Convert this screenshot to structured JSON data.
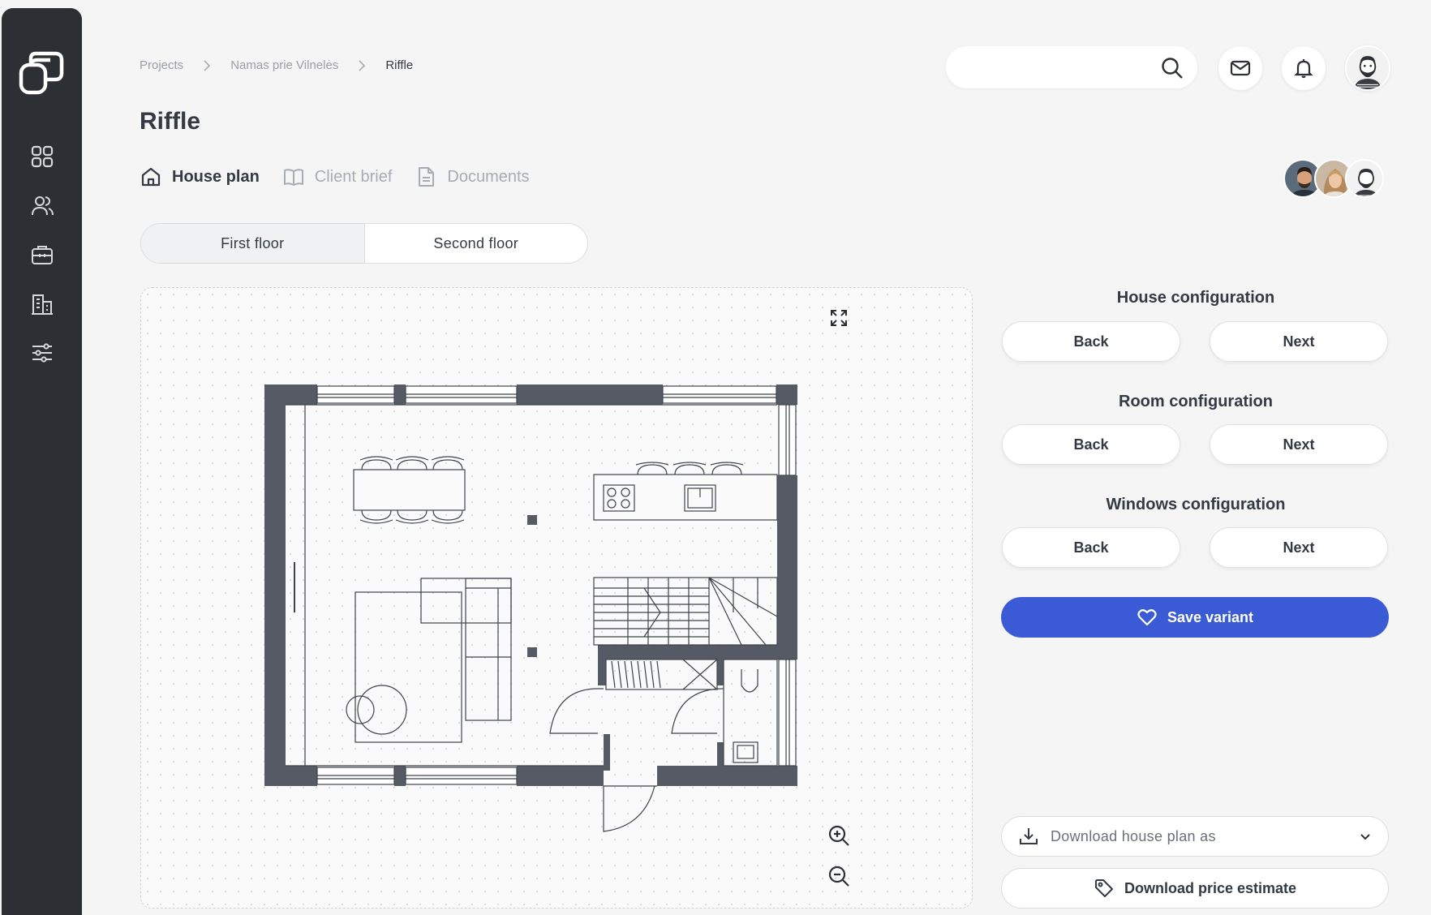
{
  "breadcrumb": {
    "items": [
      "Projects",
      "Namas prie Vilnelės",
      "Riffle"
    ]
  },
  "page": {
    "title": "Riffle"
  },
  "search": {
    "placeholder": "",
    "value": ""
  },
  "tabs": [
    {
      "label": "House plan",
      "icon": "home-icon",
      "active": true
    },
    {
      "label": "Client brief",
      "icon": "book-icon",
      "active": false
    },
    {
      "label": "Documents",
      "icon": "document-icon",
      "active": false
    }
  ],
  "floors": {
    "options": [
      "First floor",
      "Second floor"
    ],
    "selected": "First floor"
  },
  "config": [
    {
      "title": "House configuration",
      "back": "Back",
      "next": "Next"
    },
    {
      "title": "Room configuration",
      "back": "Back",
      "next": "Next"
    },
    {
      "title": "Windows configuration",
      "back": "Back",
      "next": "Next"
    }
  ],
  "actions": {
    "save_variant": "Save variant",
    "download_plan": "Download house plan as",
    "download_estimate": "Download price estimate"
  },
  "icons": {
    "sidebar": [
      "dashboard-icon",
      "users-icon",
      "briefcase-icon",
      "building-icon",
      "sliders-icon"
    ],
    "header": [
      "search-icon",
      "mail-icon",
      "bell-icon"
    ],
    "canvas": [
      "expand-icon",
      "zoom-in-icon",
      "zoom-out-icon"
    ]
  },
  "colors": {
    "sidebar_bg": "#2c2f33",
    "accent": "#3b5bd6",
    "wall": "#555a64",
    "page_bg": "#f5f5f5"
  }
}
